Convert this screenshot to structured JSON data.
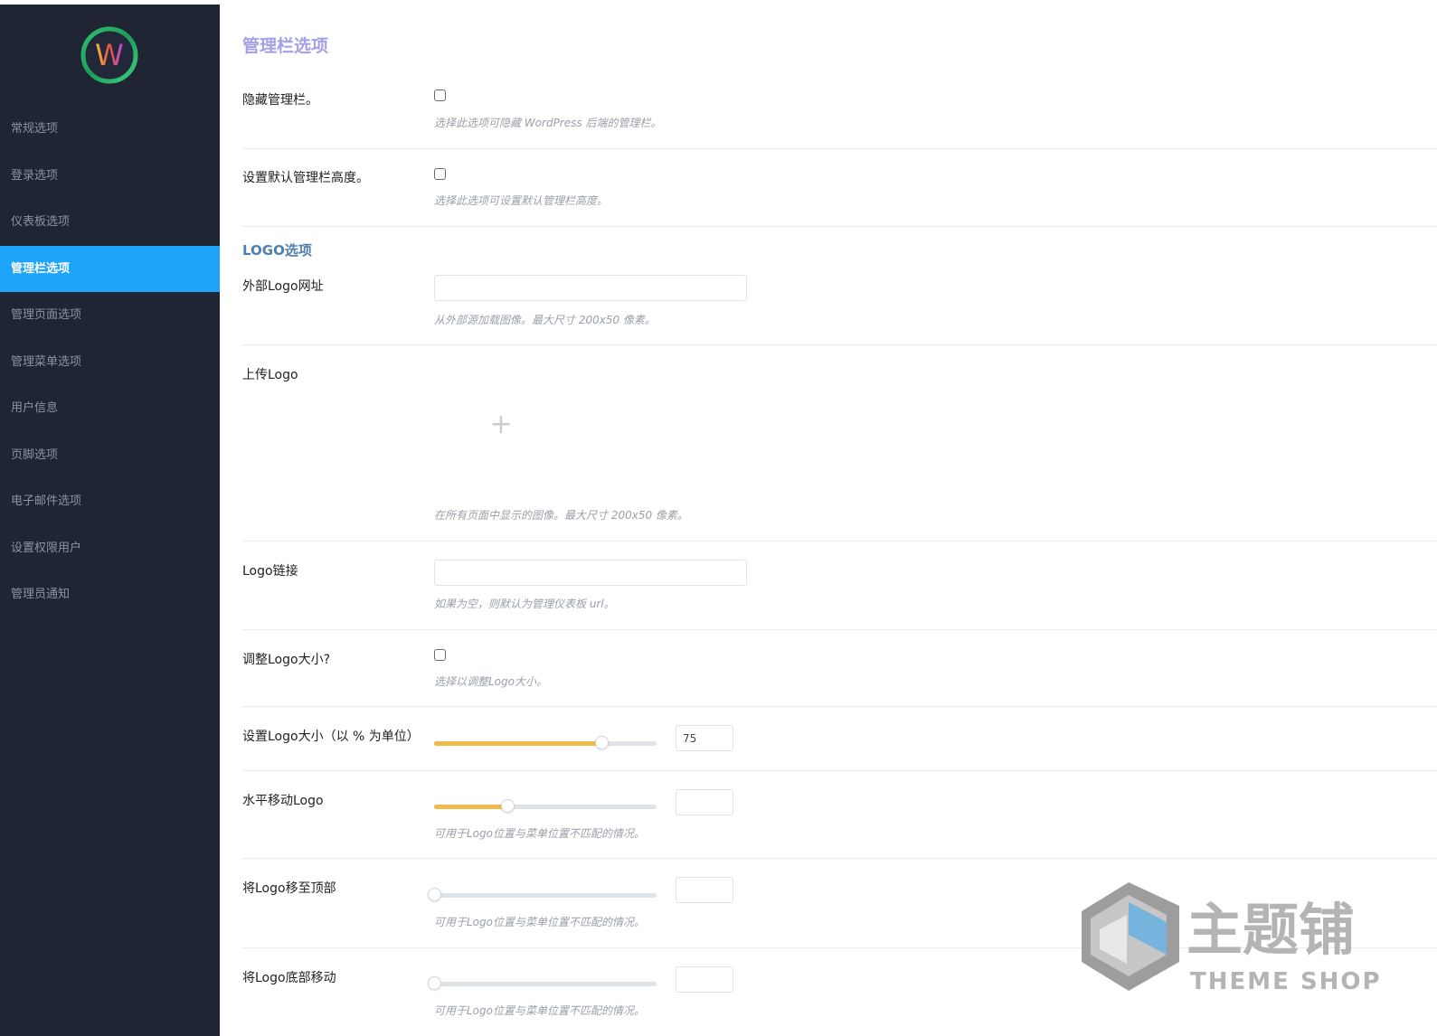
{
  "sidebar": {
    "logo_letter": "W",
    "items": [
      {
        "label": "常规选项",
        "active": false
      },
      {
        "label": "登录选项",
        "active": false
      },
      {
        "label": "仪表板选项",
        "active": false
      },
      {
        "label": "管理栏选项",
        "active": true
      },
      {
        "label": "管理页面选项",
        "active": false
      },
      {
        "label": "管理菜单选项",
        "active": false
      },
      {
        "label": "用户信息",
        "active": false
      },
      {
        "label": "页脚选项",
        "active": false
      },
      {
        "label": "电子邮件选项",
        "active": false
      },
      {
        "label": "设置权限用户",
        "active": false
      },
      {
        "label": "管理员通知",
        "active": false
      }
    ],
    "colors": {
      "background": "#1f2532",
      "active": "#1ea4f9"
    }
  },
  "main": {
    "page_title": "管理栏选项",
    "hide_admin_bar": {
      "label": "隐藏管理栏。",
      "help": "选择此选项可隐藏 WordPress 后端的管理栏。",
      "checked": false
    },
    "default_height": {
      "label": "设置默认管理栏高度。",
      "help": "选择此选项可设置默认管理栏高度。",
      "checked": false
    },
    "logo_section_title": "LOGO选项",
    "external_logo_url": {
      "label": "外部Logo网址",
      "value": "",
      "help": "从外部源加载图像。最大尺寸 200x50 像素。"
    },
    "upload_logo": {
      "label": "上传Logo",
      "plus": "+",
      "help": "在所有页面中显示的图像。最大尺寸 200x50 像素。"
    },
    "logo_link": {
      "label": "Logo链接",
      "value": "",
      "help": "如果为空，则默认为管理仪表板 url。"
    },
    "resize_logo": {
      "label": "调整Logo大小?",
      "help": "选择以调整Logo大小。",
      "checked": false
    },
    "logo_size": {
      "label": "设置Logo大小（以 % 为单位）",
      "value": "75",
      "level": 0.75
    },
    "move_horizontal": {
      "label": "水平移动Logo",
      "value": "",
      "level": 0.33,
      "help": "可用于Logo位置与菜单位置不匹配的情况。"
    },
    "move_top": {
      "label": "将Logo移至顶部",
      "value": "",
      "level": 0,
      "help": "可用于Logo位置与菜单位置不匹配的情况。"
    },
    "move_bottom": {
      "label": "将Logo底部移动",
      "value": "",
      "level": 0,
      "help": "可用于Logo位置与菜单位置不匹配的情况。"
    },
    "colors": {
      "title": "#a4a0e6",
      "section": "#4f7fae",
      "slider_fill": "#f1b84a"
    }
  },
  "watermark": {
    "brand": "主题铺",
    "sub": "THEME SHOP"
  }
}
